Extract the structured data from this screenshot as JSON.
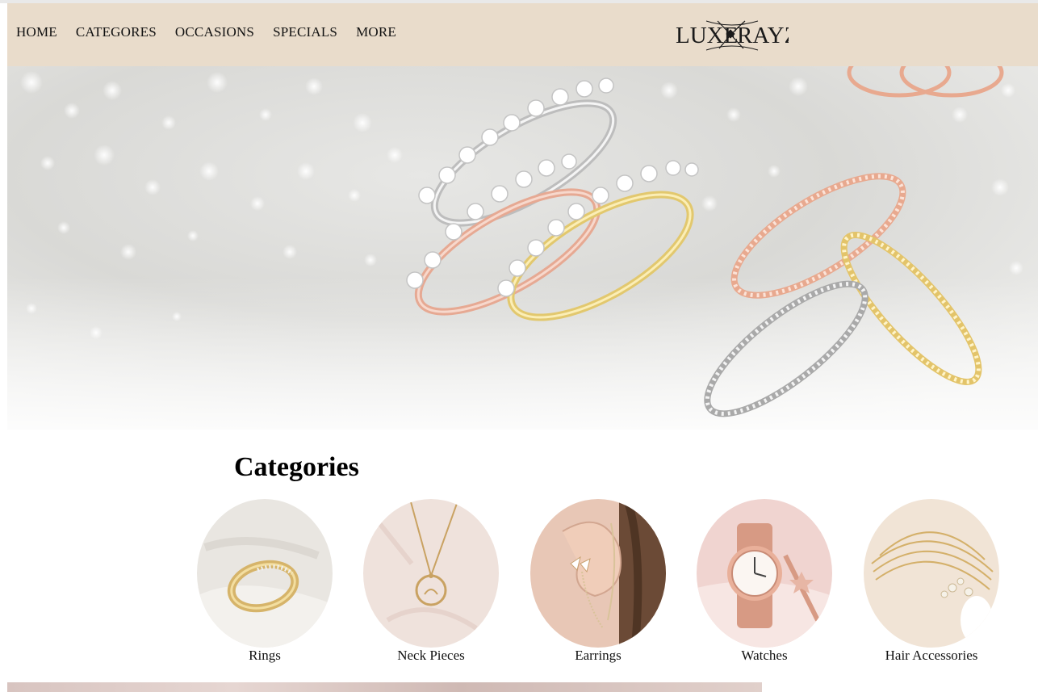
{
  "nav": {
    "items": [
      "HOME",
      "CATEGORES",
      "OCCASIONS",
      "SPECIALS",
      "MORE"
    ]
  },
  "brand": {
    "logo_left": "LUXE",
    "logo_right": "RAYZ",
    "color": "#1a1a1a"
  },
  "colors": {
    "nav_bg": "#e9dccb",
    "text": "#111111"
  },
  "hero": {
    "image": "rings-hero",
    "alt": "stacked diamond rings in silver, rose gold and gold"
  },
  "categories": {
    "title": "Categories",
    "items": [
      {
        "label": "Rings",
        "icon": "ring-icon"
      },
      {
        "label": "Neck Pieces",
        "icon": "necklace-icon"
      },
      {
        "label": "Earrings",
        "icon": "earring-icon"
      },
      {
        "label": "Watches",
        "icon": "watch-icon"
      },
      {
        "label": "Hair Accessories",
        "icon": "hair-accessory-icon"
      }
    ]
  }
}
